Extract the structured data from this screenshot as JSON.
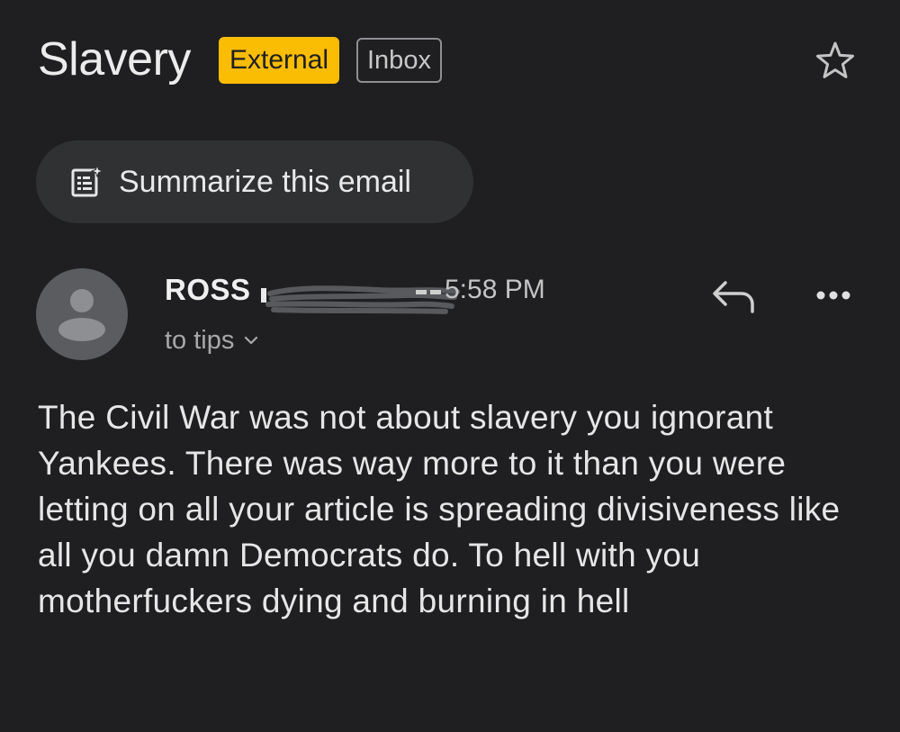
{
  "email": {
    "subject": "Slavery",
    "labels": {
      "external": "External",
      "inbox": "Inbox"
    },
    "summarize_label": "Summarize this email",
    "sender": {
      "name_visible": "ROSS",
      "time": "5:58 PM",
      "recipient": "to tips"
    },
    "body": "The Civil War was not about slavery you ignorant Yankees. There was way more to it than you were letting on all your article is spreading divisiveness like all you damn Democrats do. To hell with you motherfuckers dying and burning in hell"
  },
  "icons": {
    "star": "star-outline-icon",
    "summarize": "summarize-sparkle-icon",
    "reply": "reply-icon",
    "more": "more-horizontal-icon",
    "avatar": "default-avatar-icon",
    "chevron": "chevron-down-icon"
  },
  "colors": {
    "background": "#1f1f21",
    "external_badge": "#fbbc04",
    "pill": "#303133",
    "avatar": "#5b5c5f"
  }
}
